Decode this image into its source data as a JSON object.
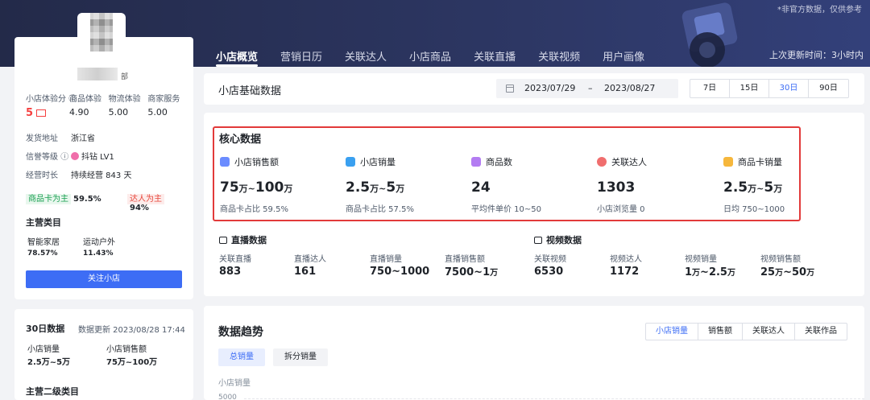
{
  "header": {
    "disclaimer": "*非官方数据，仅供参考",
    "update_time": "上次更新时间：3小时内",
    "tabs": [
      {
        "label": "小店概览",
        "active": true
      },
      {
        "label": "营销日历"
      },
      {
        "label": "关联达人"
      },
      {
        "label": "小店商品"
      },
      {
        "label": "关联直播"
      },
      {
        "label": "关联视频"
      },
      {
        "label": "用户画像"
      }
    ]
  },
  "shop": {
    "name_suffix": "部",
    "scores": [
      {
        "label": "小店体验分",
        "value": "5"
      },
      {
        "label": "商品体验",
        "value": "4.90"
      },
      {
        "label": "物流体验",
        "value": "5.00"
      },
      {
        "label": "商家服务",
        "value": "5.00"
      }
    ],
    "ship_from_label": "发货地址",
    "ship_from": "浙江省",
    "credit_label": "信誉等级",
    "credit": "抖钻 LV1",
    "duration_label": "经营时长",
    "duration": "持续经营 843 天",
    "tag1": "商品卡为主",
    "tag1_pct": "59.5%",
    "tag2": "达人为主",
    "tag2_pct": "94%",
    "main_cat_title": "主营类目",
    "categories": [
      {
        "name": "智能家居",
        "pct": "78.57%"
      },
      {
        "name": "运动户外",
        "pct": "11.43%"
      }
    ],
    "follow_label": "关注小店"
  },
  "thirty_day": {
    "title": "30日数据",
    "update": "数据更新  2023/08/28 17:44",
    "sales_label": "小店销量",
    "sales": "2.5万~5万",
    "amount_label": "小店销售额",
    "amount": "75万~100万",
    "sub_cat_title": "主营二级类目"
  },
  "basic": {
    "title": "小店基础数据",
    "date_start": "2023/07/29",
    "date_sep": "–",
    "date_end": "2023/08/27",
    "ranges": [
      {
        "label": "7日"
      },
      {
        "label": "15日"
      },
      {
        "label": "30日",
        "active": true
      },
      {
        "label": "90日"
      }
    ]
  },
  "core": {
    "title": "核心数据",
    "metrics": [
      {
        "label": "小店销售额",
        "v1": "75",
        "u1": "万",
        "sep": "~",
        "v2": "100",
        "u2": "万",
        "sub": "商品卡占比 59.5%",
        "color": "#6b8cff"
      },
      {
        "label": "小店销量",
        "v1": "2.5",
        "u1": "万",
        "sep": "~",
        "v2": "5",
        "u2": "万",
        "sub": "商品卡占比 57.5%",
        "color": "#3aa0f0"
      },
      {
        "label": "商品数",
        "v1": "24",
        "sub": "平均件单价 10~50",
        "color": "#b37cf2"
      },
      {
        "label": "关联达人",
        "v1": "1303",
        "sub": "小店浏览量 0",
        "color": "#f06e6e"
      },
      {
        "label": "商品卡销量",
        "v1": "2.5",
        "u1": "万",
        "sep": "~",
        "v2": "5",
        "u2": "万",
        "sub": "日均 750~1000",
        "color": "#f6b73c"
      }
    ]
  },
  "live": {
    "title": "直播数据",
    "items": [
      {
        "label": "关联直播",
        "value": "883"
      },
      {
        "label": "直播达人",
        "value": "161"
      },
      {
        "label": "直播销量",
        "value": "750~1000"
      },
      {
        "label": "直播销售额",
        "value": "7500~1",
        "unit": "万"
      }
    ]
  },
  "video": {
    "title": "视频数据",
    "items": [
      {
        "label": "关联视频",
        "value": "6530"
      },
      {
        "label": "视频达人",
        "value": "1172"
      },
      {
        "label": "视频销量",
        "v1": "1",
        "u1": "万",
        "v2": "~2.5",
        "u2": "万"
      },
      {
        "label": "视频销售额",
        "v1": "25",
        "u1": "万",
        "v2": "~50",
        "u2": "万"
      }
    ]
  },
  "trend": {
    "title": "数据趋势",
    "tabs": [
      {
        "label": "小店销量",
        "active": true
      },
      {
        "label": "销售额"
      },
      {
        "label": "关联达人"
      },
      {
        "label": "关联作品"
      }
    ],
    "sub_tabs": [
      {
        "label": "总销量",
        "active": true
      },
      {
        "label": "拆分销量"
      }
    ],
    "y_title": "小店销量",
    "y_tick": "5000"
  }
}
